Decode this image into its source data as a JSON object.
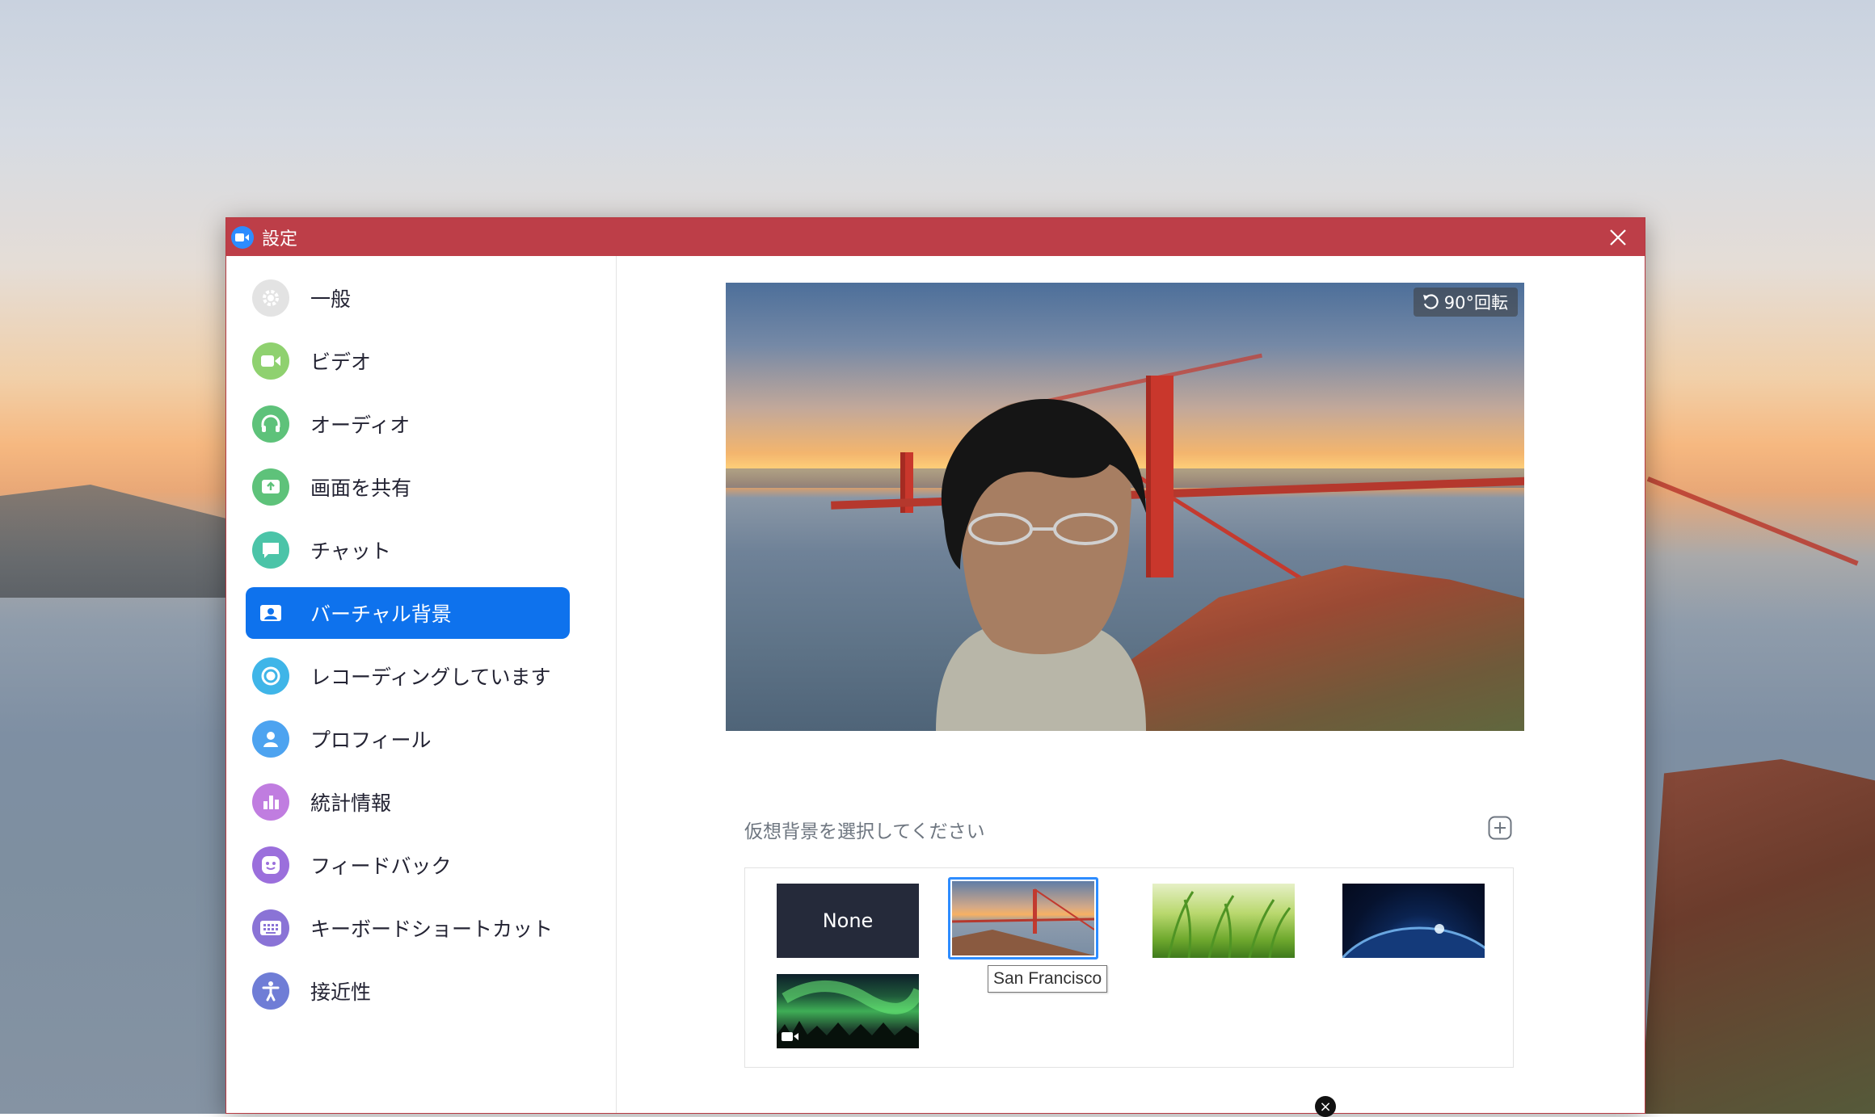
{
  "window": {
    "title": "設定",
    "rotate_label": "90°回転"
  },
  "sidebar": {
    "items": [
      {
        "label": "一般",
        "icon": "gear-icon",
        "color": "#e3e3e3"
      },
      {
        "label": "ビデオ",
        "icon": "video-icon",
        "color": "#8fd16f"
      },
      {
        "label": "オーディオ",
        "icon": "headphones-icon",
        "color": "#5ec27a"
      },
      {
        "label": "画面を共有",
        "icon": "share-screen-icon",
        "color": "#5ec27a"
      },
      {
        "label": "チャット",
        "icon": "chat-icon",
        "color": "#4bc4a8"
      },
      {
        "label": "バーチャル背景",
        "icon": "virtual-background-icon",
        "color": "#0e72ed",
        "active": true
      },
      {
        "label": "レコーディングしています",
        "icon": "record-icon",
        "color": "#3fb5e8"
      },
      {
        "label": "プロフィール",
        "icon": "profile-icon",
        "color": "#4da3f0"
      },
      {
        "label": "統計情報",
        "icon": "statistics-icon",
        "color": "#c07de0"
      },
      {
        "label": "フィードバック",
        "icon": "feedback-icon",
        "color": "#9b6fdc"
      },
      {
        "label": "キーボードショートカット",
        "icon": "keyboard-icon",
        "color": "#8a73d6"
      },
      {
        "label": "接近性",
        "icon": "accessibility-icon",
        "color": "#6f7dd6"
      }
    ]
  },
  "main": {
    "choose_label": "仮想背景を選択してください",
    "backgrounds": [
      {
        "label": "None"
      },
      {
        "label": "San Francisco"
      },
      {
        "label": ""
      },
      {
        "label": ""
      },
      {
        "label": ""
      }
    ],
    "tooltip": "San Francisco"
  }
}
